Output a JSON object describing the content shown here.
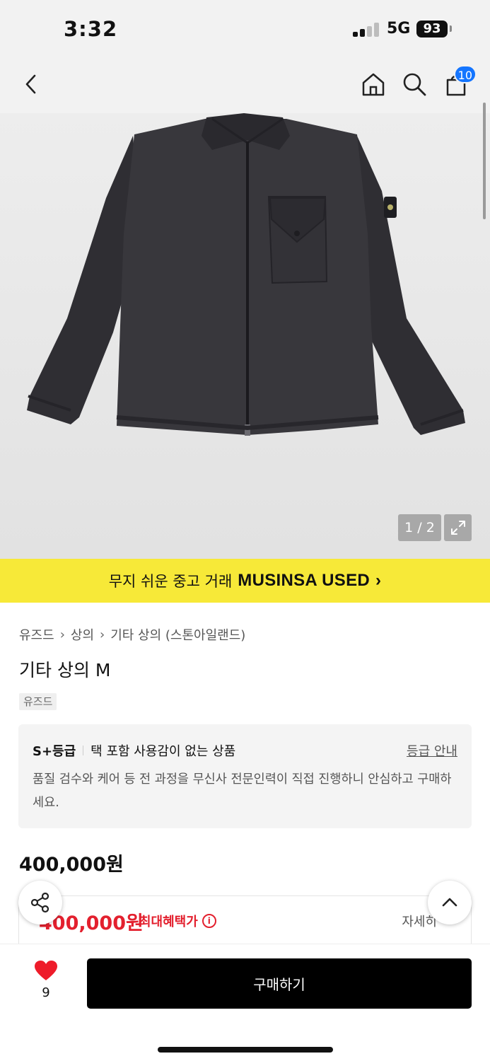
{
  "status_bar": {
    "time": "3:32",
    "network": "5G",
    "battery": "93"
  },
  "nav": {
    "cart_count": "10"
  },
  "gallery": {
    "counter": "1 / 2"
  },
  "banner": {
    "text": "무지 쉬운 중고 거래",
    "brand": "MUSINSA USED",
    "chevron": "›"
  },
  "breadcrumb": {
    "items": [
      "유즈드",
      "상의",
      "기타 상의 (스톤아일랜드)"
    ],
    "separator": "›"
  },
  "product": {
    "title": "기타 상의 M",
    "tag": "유즈드",
    "price": "400,000원"
  },
  "grade": {
    "label": "S+등급",
    "summary": "택 포함 사용감이 없는 상품",
    "link": "등급 안내",
    "description": "품질 검수와 케어 등 전 과정을 무신사 전문인력이 직접 진행하니 안심하고 구매하세요."
  },
  "benefit": {
    "price": "400,000원",
    "label": "최대혜택가",
    "detail": "자세히"
  },
  "bottom": {
    "like_count": "9",
    "buy_label": "구매하기"
  },
  "colors": {
    "accent_yellow": "#f7e938",
    "sale_red": "#e3202e",
    "badge_blue": "#1475ff"
  }
}
